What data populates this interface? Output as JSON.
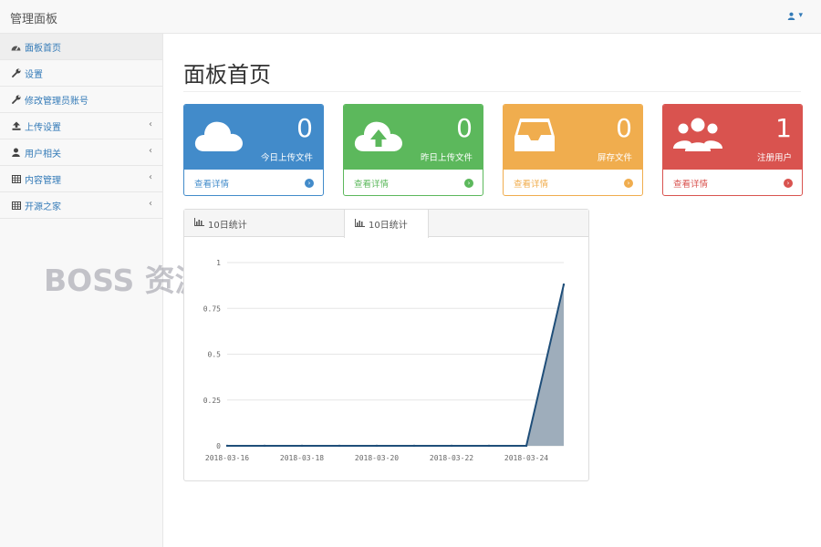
{
  "navbar": {
    "brand": "管理面板",
    "user_caret": "▾"
  },
  "sidebar": {
    "items": [
      {
        "label": "面板首页",
        "icon": "dashboard-icon",
        "active": true,
        "has_arrow": false
      },
      {
        "label": "设置",
        "icon": "wrench-icon",
        "active": false,
        "has_arrow": false
      },
      {
        "label": "修改管理员账号",
        "icon": "wrench-icon",
        "active": false,
        "has_arrow": false
      },
      {
        "label": "上传设置",
        "icon": "upload-icon",
        "active": false,
        "has_arrow": true
      },
      {
        "label": "用户相关",
        "icon": "user-icon",
        "active": false,
        "has_arrow": true
      },
      {
        "label": "内容管理",
        "icon": "table-icon",
        "active": false,
        "has_arrow": true
      },
      {
        "label": "开源之家",
        "icon": "table-icon",
        "active": false,
        "has_arrow": true
      }
    ],
    "arrow": "‹"
  },
  "watermark": "BOSS 资源",
  "main": {
    "title": "面板首页",
    "cards": [
      {
        "value": "0",
        "caption": "今日上传文件",
        "link": "查看详情",
        "icon": "cloud-icon",
        "color": "#428bca",
        "foot_color": "#428bca"
      },
      {
        "value": "0",
        "caption": "昨日上传文件",
        "link": "查看详情",
        "icon": "cloud-upload-icon",
        "color": "#5cb85c",
        "foot_color": "#5cb85c"
      },
      {
        "value": "0",
        "caption": "屏存文件",
        "link": "查看详情",
        "icon": "inbox-icon",
        "color": "#f0ad4e",
        "foot_color": "#f0ad4e"
      },
      {
        "value": "1",
        "caption": "注册用户",
        "link": "查看详情",
        "icon": "users-icon",
        "color": "#d9534f",
        "foot_color": "#d9534f"
      }
    ],
    "chart_panel": {
      "tabs": [
        {
          "label": "10日统计"
        },
        {
          "label": "10日统计"
        }
      ]
    }
  },
  "chart_data": {
    "type": "area",
    "x": [
      "2018-03-16",
      "2018-03-17",
      "2018-03-18",
      "2018-03-19",
      "2018-03-20",
      "2018-03-21",
      "2018-03-22",
      "2018-03-23",
      "2018-03-24",
      "2018-03-25"
    ],
    "x_tick_labels": [
      "2018-03-16",
      "2018-03-18",
      "2018-03-20",
      "2018-03-22",
      "2018-03-24"
    ],
    "series": [
      {
        "values": [
          0,
          0,
          0,
          0,
          0,
          0,
          0,
          0,
          0,
          0.88
        ],
        "color": "#1f4e79",
        "fill": "#9eadbb"
      }
    ],
    "y_ticks": [
      "0",
      "0.25",
      "0.5",
      "0.75",
      "1"
    ],
    "ylim": [
      0,
      1
    ],
    "grid": true
  }
}
